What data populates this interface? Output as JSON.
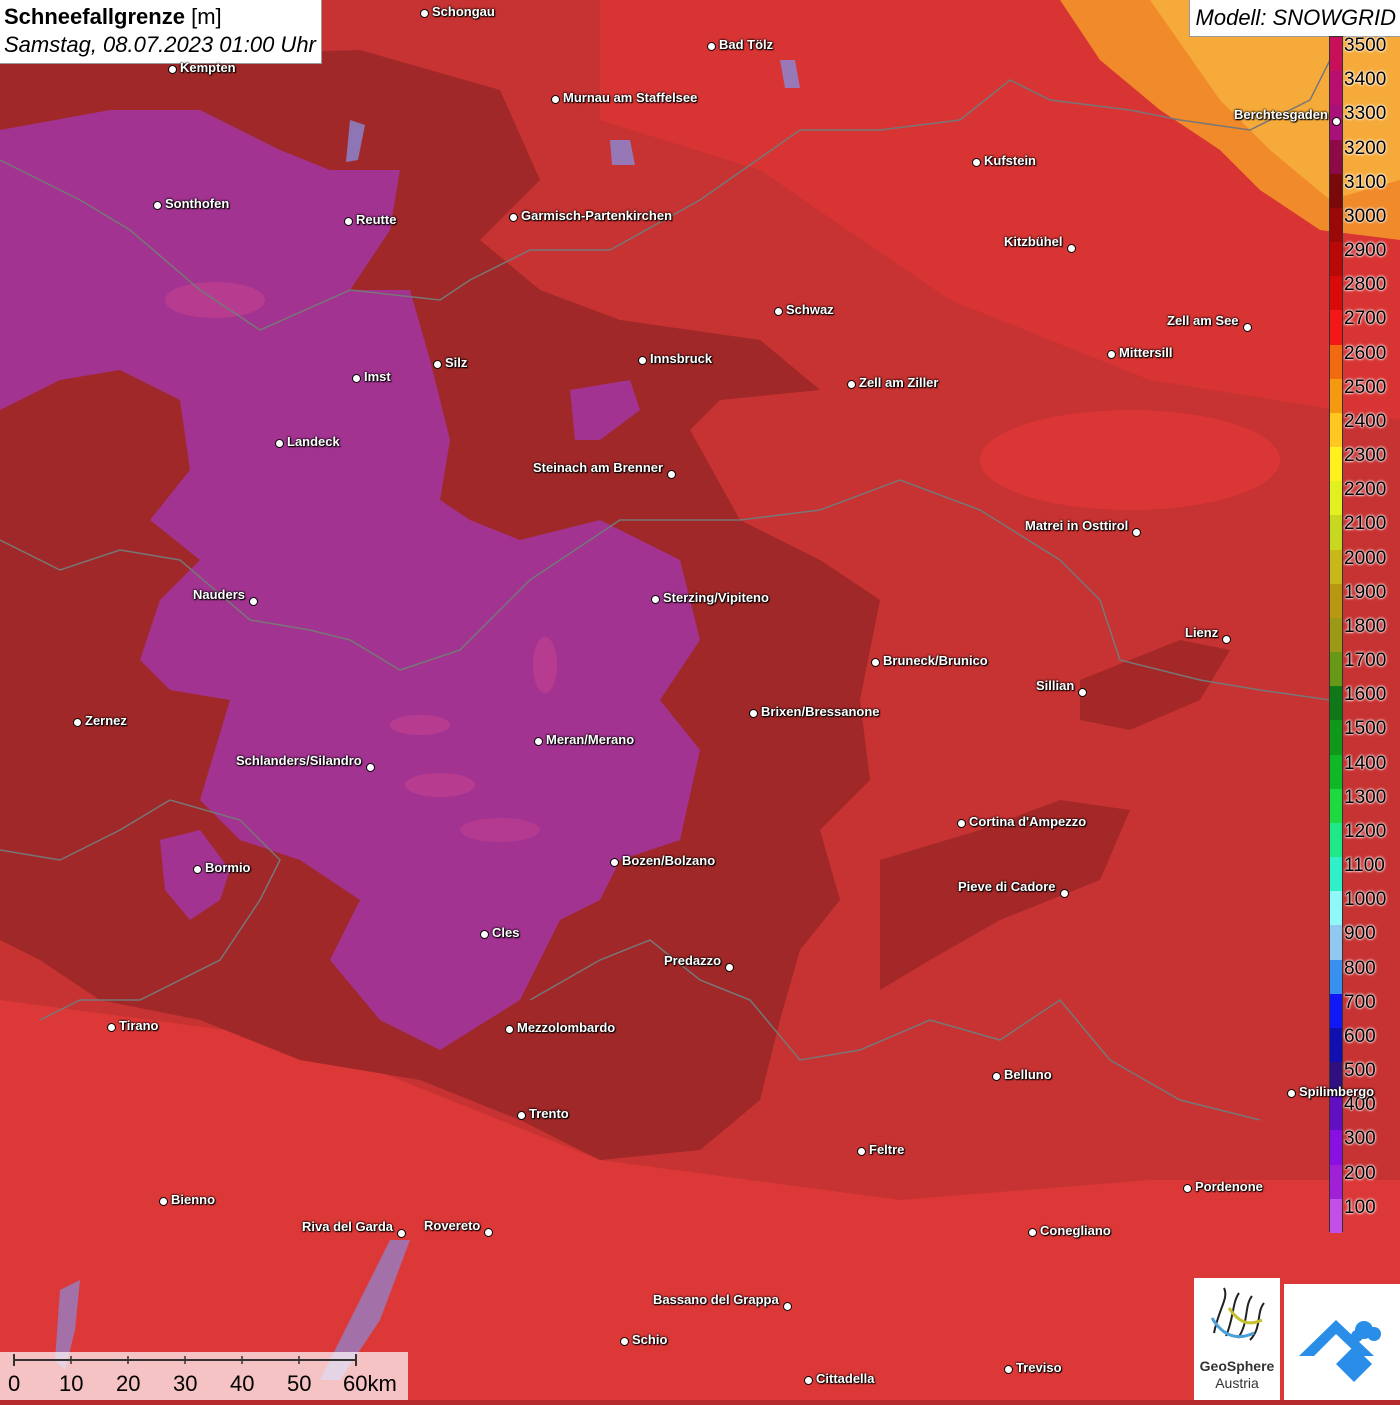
{
  "title": {
    "label_bold": "Schneefallgrenze",
    "label_unit": "[m]",
    "datetime": "Samstag, 08.07.2023 01:00 Uhr"
  },
  "model": "Modell: SNOWGRID",
  "legend": {
    "levels": [
      {
        "value": "3500",
        "color": "#c8105a"
      },
      {
        "value": "3400",
        "color": "#b80e6e"
      },
      {
        "value": "3300",
        "color": "#a8107a"
      },
      {
        "value": "3200",
        "color": "#8c0a46"
      },
      {
        "value": "3100",
        "color": "#7a0a0a"
      },
      {
        "value": "3000",
        "color": "#9a0808"
      },
      {
        "value": "2900",
        "color": "#b80808"
      },
      {
        "value": "2800",
        "color": "#d80a0a"
      },
      {
        "value": "2700",
        "color": "#f21818"
      },
      {
        "value": "2600",
        "color": "#f26a10"
      },
      {
        "value": "2500",
        "color": "#f59a10"
      },
      {
        "value": "2400",
        "color": "#ffc820"
      },
      {
        "value": "2300",
        "color": "#fff020"
      },
      {
        "value": "2200",
        "color": "#e0f020"
      },
      {
        "value": "2100",
        "color": "#c8d820"
      },
      {
        "value": "2000",
        "color": "#c8b818"
      },
      {
        "value": "1900",
        "color": "#b89810"
      },
      {
        "value": "1800",
        "color": "#9c9818"
      },
      {
        "value": "1700",
        "color": "#689818"
      },
      {
        "value": "1600",
        "color": "#107818"
      },
      {
        "value": "1500",
        "color": "#109818"
      },
      {
        "value": "1400",
        "color": "#10b828"
      },
      {
        "value": "1300",
        "color": "#20d840"
      },
      {
        "value": "1200",
        "color": "#20e888"
      },
      {
        "value": "1100",
        "color": "#30f0c8"
      },
      {
        "value": "1000",
        "color": "#90f8f8"
      },
      {
        "value": "900",
        "color": "#90c8f0"
      },
      {
        "value": "800",
        "color": "#3890f0"
      },
      {
        "value": "700",
        "color": "#1018f8"
      },
      {
        "value": "600",
        "color": "#1010b0"
      },
      {
        "value": "500",
        "color": "#301080"
      },
      {
        "value": "400",
        "color": "#6010c0"
      },
      {
        "value": "300",
        "color": "#8810e0"
      },
      {
        "value": "200",
        "color": "#a020d8"
      },
      {
        "value": "100",
        "color": "#c050e8"
      }
    ]
  },
  "cities": [
    {
      "name": "Schongau",
      "label_side": "right"
    },
    {
      "name": "Bad Tölz",
      "label_side": "right"
    },
    {
      "name": "Kempten",
      "label_side": "right"
    },
    {
      "name": "Murnau am Staffelsee",
      "label_side": "right"
    },
    {
      "name": "Berchtesgaden",
      "label_side": "left"
    },
    {
      "name": "Kufstein",
      "label_side": "right"
    },
    {
      "name": "Sonthofen",
      "label_side": "right"
    },
    {
      "name": "Reutte",
      "label_side": "right"
    },
    {
      "name": "Garmisch-Partenkirchen",
      "label_side": "right"
    },
    {
      "name": "Kitzbühel",
      "label_side": "left"
    },
    {
      "name": "Schwaz",
      "label_side": "right"
    },
    {
      "name": "Zell am See",
      "label_side": "left"
    },
    {
      "name": "Innsbruck",
      "label_side": "right"
    },
    {
      "name": "Mittersill",
      "label_side": "right"
    },
    {
      "name": "Silz",
      "label_side": "right"
    },
    {
      "name": "Imst",
      "label_side": "right"
    },
    {
      "name": "Zell am Ziller",
      "label_side": "right"
    },
    {
      "name": "Landeck",
      "label_side": "right"
    },
    {
      "name": "Steinach am Brenner",
      "label_side": "left"
    },
    {
      "name": "Matrei in Osttirol",
      "label_side": "left"
    },
    {
      "name": "Nauders",
      "label_side": "left"
    },
    {
      "name": "Sterzing/Vipiteno",
      "label_side": "right"
    },
    {
      "name": "Lienz",
      "label_side": "left"
    },
    {
      "name": "Bruneck/Brunico",
      "label_side": "right"
    },
    {
      "name": "Sillian",
      "label_side": "left"
    },
    {
      "name": "Brixen/Bressanone",
      "label_side": "right"
    },
    {
      "name": "Zernez",
      "label_side": "right"
    },
    {
      "name": "Meran/Merano",
      "label_side": "right"
    },
    {
      "name": "Schlanders/Silandro",
      "label_side": "left"
    },
    {
      "name": "Cortina d'Ampezzo",
      "label_side": "right"
    },
    {
      "name": "Bozen/Bolzano",
      "label_side": "right"
    },
    {
      "name": "Bormio",
      "label_side": "right"
    },
    {
      "name": "Pieve di Cadore",
      "label_side": "left"
    },
    {
      "name": "Cles",
      "label_side": "right"
    },
    {
      "name": "Predazzo",
      "label_side": "left"
    },
    {
      "name": "Tirano",
      "label_side": "right"
    },
    {
      "name": "Mezzolombardo",
      "label_side": "right"
    },
    {
      "name": "Belluno",
      "label_side": "right"
    },
    {
      "name": "Spilimbergo",
      "label_side": "right"
    },
    {
      "name": "Trento",
      "label_side": "right"
    },
    {
      "name": "Feltre",
      "label_side": "right"
    },
    {
      "name": "Pordenone",
      "label_side": "right"
    },
    {
      "name": "Bienno",
      "label_side": "right"
    },
    {
      "name": "Riva del Garda",
      "label_side": "left"
    },
    {
      "name": "Rovereto",
      "label_side": "left"
    },
    {
      "name": "Conegliano",
      "label_side": "right"
    },
    {
      "name": "Bassano del Grappa",
      "label_side": "left"
    },
    {
      "name": "Schio",
      "label_side": "right"
    },
    {
      "name": "Treviso",
      "label_side": "right"
    },
    {
      "name": "Cittadella",
      "label_side": "right"
    }
  ],
  "scale_bar": {
    "labels": [
      "0",
      "10",
      "20",
      "30",
      "40",
      "50",
      "60km"
    ]
  },
  "logos": {
    "geosphere_line1": "GeoSphere",
    "geosphere_line2": "Austria"
  },
  "colors": {
    "base_red": "#b62c2c",
    "dark_red": "#8a2323",
    "magenta": "#a0308a",
    "bright_red": "#e43030",
    "orange": "#f2962a"
  }
}
